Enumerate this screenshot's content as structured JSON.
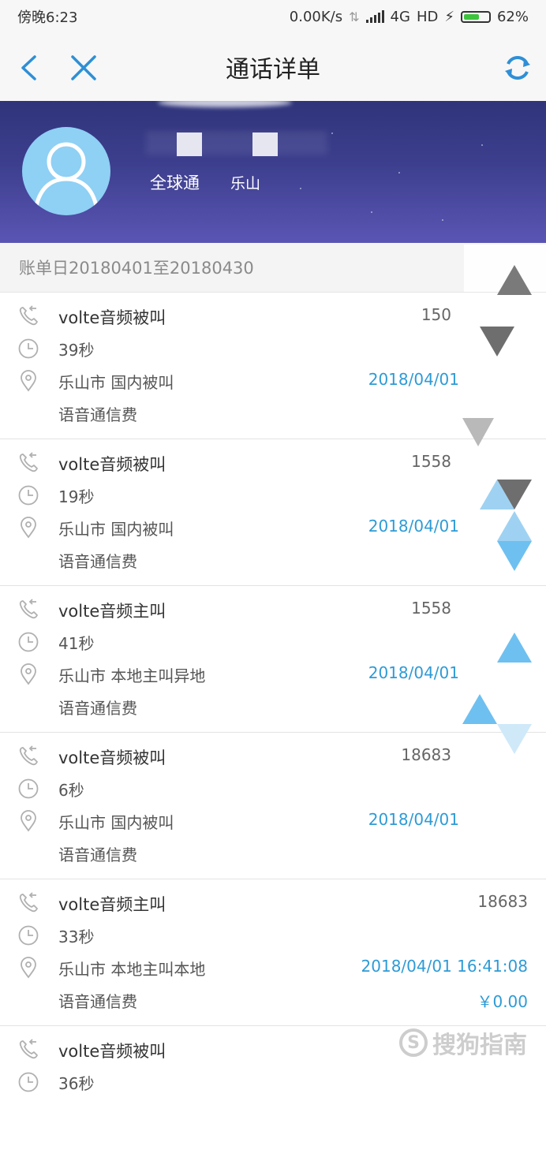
{
  "status_bar": {
    "time": "傍晚6:23",
    "speed": "0.00K/s",
    "network": "4G",
    "hd": "HD",
    "battery": "62%",
    "battery_level": 0.62,
    "battery_color": "#3cc43c"
  },
  "nav": {
    "title": "通话详单",
    "back_icon": "chevron-left-icon",
    "close_icon": "close-icon",
    "refresh_icon": "refresh-icon",
    "accent": "#2e8fd6"
  },
  "profile": {
    "plan": "全球通",
    "city": "乐山"
  },
  "bill_period": "账单日20180401至20180430",
  "records": [
    {
      "type": "volte音频被叫",
      "number": "150",
      "duration": "39秒",
      "location": "乐山市 国内被叫",
      "datetime": "2018/04/01",
      "fee_type": "语音通信费",
      "fee": ""
    },
    {
      "type": "volte音频被叫",
      "number": "1558",
      "duration": "19秒",
      "location": "乐山市 国内被叫",
      "datetime": "2018/04/01",
      "fee_type": "语音通信费",
      "fee": ""
    },
    {
      "type": "volte音频主叫",
      "number": "1558",
      "duration": "41秒",
      "location": "乐山市 本地主叫异地",
      "datetime": "2018/04/01",
      "fee_type": "语音通信费",
      "fee": ""
    },
    {
      "type": "volte音频被叫",
      "number": "18683",
      "duration": "6秒",
      "location": "乐山市 国内被叫",
      "datetime": "2018/04/01",
      "fee_type": "语音通信费",
      "fee": ""
    },
    {
      "type": "volte音频主叫",
      "number": "18683",
      "duration": "33秒",
      "location": "乐山市 本地主叫本地",
      "datetime": "2018/04/01 16:41:08",
      "fee_type": "语音通信费",
      "fee": "￥0.00"
    },
    {
      "type": "volte音频被叫",
      "number": "",
      "duration": "36秒",
      "location": "",
      "datetime": "",
      "fee_type": "",
      "fee": ""
    }
  ],
  "icons": {
    "call": "phone-call-icon",
    "duration": "clock-icon",
    "location": "location-pin-icon"
  },
  "watermark": {
    "text": "搜狗指南",
    "badge": "S"
  }
}
